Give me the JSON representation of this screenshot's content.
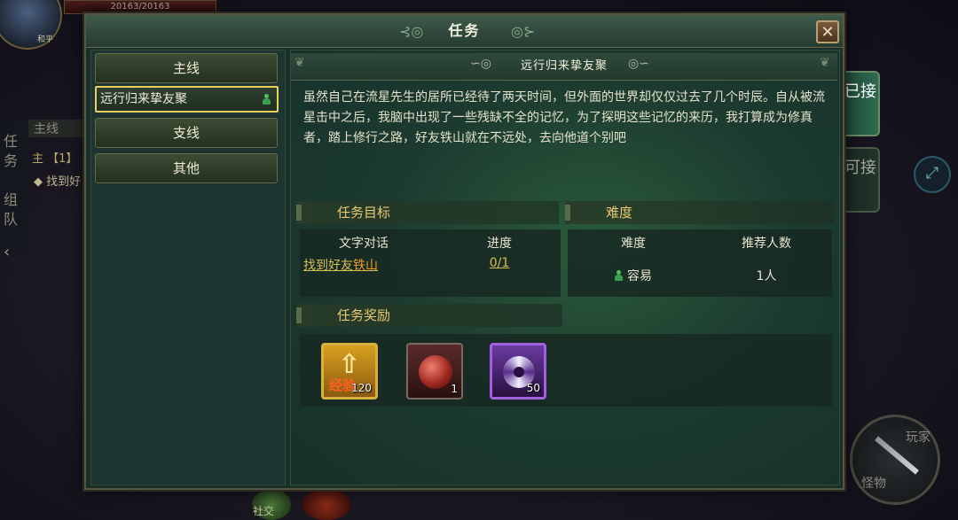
{
  "hud": {
    "hp_text": "20163/20163",
    "level_badge": "和平",
    "side_tabs": [
      "任",
      "务",
      "组",
      "队"
    ],
    "bg_quest_tab": "主线",
    "bg_quest_line1": "主 【1】",
    "bg_quest_line2": "◆ 找到好",
    "social_label": "社交",
    "skill_label_top": "玩家",
    "skill_label_bottom": "怪物"
  },
  "window": {
    "title": "任务",
    "close_label": "✕"
  },
  "right_tabs": [
    {
      "label": "已接"
    },
    {
      "label": "可接"
    }
  ],
  "nav": [
    {
      "label": "主线"
    },
    {
      "label": "远行归来挚友聚"
    },
    {
      "label": "支线"
    },
    {
      "label": "其他"
    }
  ],
  "quest": {
    "title": "远行归来挚友聚",
    "description": "虽然自己在流星先生的居所已经待了两天时间，但外面的世界却仅仅过去了几个时辰。自从被流星击中之后，我脑中出现了一些残缺不全的记忆，为了探明这些记忆的来历，我打算成为修真者，踏上修行之路，好友铁山就在不远处，去向他道个别吧",
    "objectives": {
      "heading": "任务目标",
      "col_task": "文字对话",
      "col_progress": "进度",
      "task_prefix": "找到好友",
      "task_target": "铁山",
      "progress": "0/1"
    },
    "difficulty": {
      "heading": "难度",
      "col_difficulty": "难度",
      "col_players": "推荐人数",
      "value": "容易",
      "players": "1人"
    },
    "rewards": {
      "heading": "任务奖励",
      "items": [
        {
          "name": "经验",
          "qty": "120",
          "icon": "exp-icon"
        },
        {
          "name": "red-orb",
          "qty": "1",
          "icon": "red-orb-icon"
        },
        {
          "name": "purple-rune",
          "qty": "50",
          "icon": "purple-rune-icon"
        }
      ]
    }
  }
}
